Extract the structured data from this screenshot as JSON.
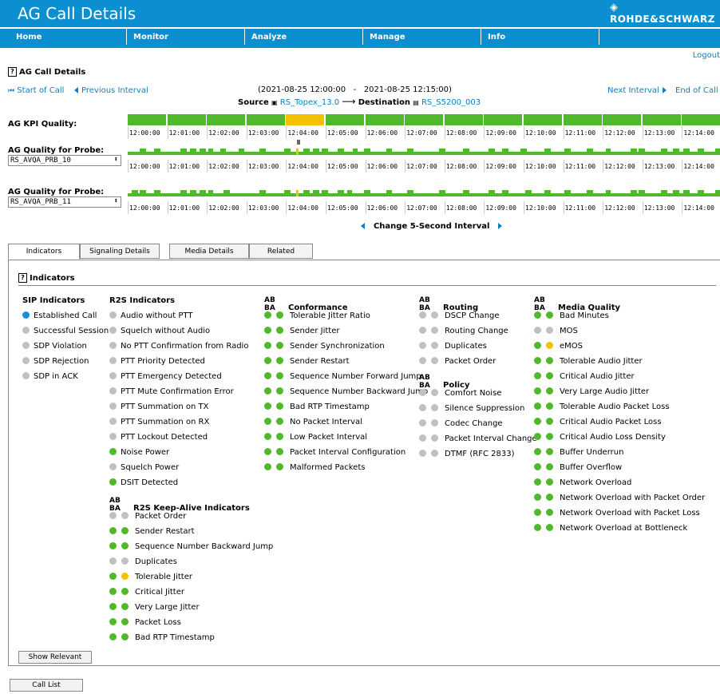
{
  "app": {
    "title": "AG Call Details",
    "brand": "ROHDE&SCHWARZ"
  },
  "menu": [
    "Home",
    "Monitor",
    "Analyze",
    "Manage",
    "Info"
  ],
  "logout": "Logout",
  "section_title": "AG Call Details",
  "nav": {
    "start": "Start of Call",
    "prev": "Previous Interval",
    "next": "Next Interval",
    "end": "End of Call"
  },
  "interval": {
    "from": "(2021-08-25 12:00:00",
    "sep": "-",
    "to": "2021-08-25 12:15:00)"
  },
  "source": {
    "label": "Source",
    "name": "RS_Topex_13.0"
  },
  "destination": {
    "label": "Destination",
    "name": "RS_S5200_003"
  },
  "kpi": {
    "label": "AG KPI Quality:",
    "segments": [
      "good",
      "good",
      "good",
      "good",
      "warn",
      "good",
      "good",
      "good",
      "good",
      "good",
      "good",
      "good",
      "good",
      "good",
      "good"
    ]
  },
  "ticks": [
    "12:00:00",
    "12:01:00",
    "12:02:00",
    "12:03:00",
    "12:04:00",
    "12:05:00",
    "12:06:00",
    "12:07:00",
    "12:08:00",
    "12:09:00",
    "12:10:00",
    "12:11:00",
    "12:12:00",
    "12:13:00",
    "12:14:00"
  ],
  "probe1": {
    "label": "AG Quality for Probe:",
    "value": "RS_AVQA_PRB_10"
  },
  "probe2": {
    "label": "AG Quality for Probe:",
    "value": "RS_AVQA_PRB_11"
  },
  "change_interval": "Change 5-Second Interval",
  "tabs": [
    "Indicators",
    "Signaling Details",
    "Media Details",
    "Related"
  ],
  "indicators_title": "Indicators",
  "ab_ba": "AB BA",
  "colors": {
    "blue": "#1a8ed4",
    "gray": "#c0c0c0",
    "green": "#4fb82b",
    "yellow": "#f5c000"
  },
  "sip": {
    "title": "SIP Indicators",
    "items": [
      {
        "label": "Established Call",
        "c": "blue"
      },
      {
        "label": "Successful Session",
        "c": "gray"
      },
      {
        "label": "SDP Violation",
        "c": "gray"
      },
      {
        "label": "SDP Rejection",
        "c": "gray"
      },
      {
        "label": "SDP in ACK",
        "c": "gray"
      }
    ]
  },
  "r2s": {
    "title": "R2S Indicators",
    "items": [
      {
        "label": "Audio without PTT",
        "c": "gray"
      },
      {
        "label": "Squelch without Audio",
        "c": "gray"
      },
      {
        "label": "No PTT Confirmation from Radio",
        "c": "gray"
      },
      {
        "label": "PTT Priority Detected",
        "c": "gray"
      },
      {
        "label": "PTT Emergency Detected",
        "c": "gray"
      },
      {
        "label": "PTT Mute Confirmation Error",
        "c": "gray"
      },
      {
        "label": "PTT Summation on TX",
        "c": "gray"
      },
      {
        "label": "PTT Summation on RX",
        "c": "gray"
      },
      {
        "label": "PTT Lockout Detected",
        "c": "gray"
      },
      {
        "label": "Noise Power",
        "c": "green"
      },
      {
        "label": "Squelch Power",
        "c": "gray"
      },
      {
        "label": "DSIT Detected",
        "c": "green"
      }
    ]
  },
  "keepalive": {
    "title": "R2S Keep-Alive Indicators",
    "items": [
      {
        "label": "Packet Order",
        "a": "gray",
        "b": "gray"
      },
      {
        "label": "Sender Restart",
        "a": "green",
        "b": "green"
      },
      {
        "label": "Sequence Number Backward Jump",
        "a": "green",
        "b": "green"
      },
      {
        "label": "Duplicates",
        "a": "gray",
        "b": "gray"
      },
      {
        "label": "Tolerable Jitter",
        "a": "green",
        "b": "yellow"
      },
      {
        "label": "Critical Jitter",
        "a": "green",
        "b": "green"
      },
      {
        "label": "Very Large Jitter",
        "a": "green",
        "b": "green"
      },
      {
        "label": "Packet Loss",
        "a": "green",
        "b": "green"
      },
      {
        "label": "Bad RTP Timestamp",
        "a": "green",
        "b": "green"
      }
    ]
  },
  "conformance": {
    "title": "Conformance",
    "items": [
      {
        "label": "Tolerable Jitter Ratio",
        "a": "green",
        "b": "green"
      },
      {
        "label": "Sender Jitter",
        "a": "green",
        "b": "green"
      },
      {
        "label": "Sender Synchronization",
        "a": "green",
        "b": "green"
      },
      {
        "label": "Sender Restart",
        "a": "green",
        "b": "green"
      },
      {
        "label": "Sequence Number Forward Jump",
        "a": "green",
        "b": "green"
      },
      {
        "label": "Sequence Number Backward Jump",
        "a": "green",
        "b": "green"
      },
      {
        "label": "Bad RTP Timestamp",
        "a": "green",
        "b": "green"
      },
      {
        "label": "No Packet Interval",
        "a": "green",
        "b": "green"
      },
      {
        "label": "Low Packet Interval",
        "a": "green",
        "b": "green"
      },
      {
        "label": "Packet Interval Configuration",
        "a": "green",
        "b": "green"
      },
      {
        "label": "Malformed Packets",
        "a": "green",
        "b": "green"
      }
    ]
  },
  "routing": {
    "title": "Routing",
    "items": [
      {
        "label": "DSCP Change",
        "a": "gray",
        "b": "gray"
      },
      {
        "label": "Routing Change",
        "a": "gray",
        "b": "gray"
      },
      {
        "label": "Duplicates",
        "a": "gray",
        "b": "gray"
      },
      {
        "label": "Packet Order",
        "a": "gray",
        "b": "gray"
      }
    ]
  },
  "policy": {
    "title": "Policy",
    "items": [
      {
        "label": "Comfort Noise",
        "a": "gray",
        "b": "gray"
      },
      {
        "label": "Silence Suppression",
        "a": "gray",
        "b": "gray"
      },
      {
        "label": "Codec Change",
        "a": "gray",
        "b": "gray"
      },
      {
        "label": "Packet Interval Change",
        "a": "gray",
        "b": "gray"
      },
      {
        "label": "DTMF (RFC 2833)",
        "a": "gray",
        "b": "gray"
      }
    ]
  },
  "media": {
    "title": "Media Quality",
    "items": [
      {
        "label": "Bad Minutes",
        "a": "green",
        "b": "green"
      },
      {
        "label": "MOS",
        "a": "gray",
        "b": "gray"
      },
      {
        "label": "eMOS",
        "a": "green",
        "b": "yellow"
      },
      {
        "label": "Tolerable Audio Jitter",
        "a": "green",
        "b": "green"
      },
      {
        "label": "Critical Audio Jitter",
        "a": "green",
        "b": "green"
      },
      {
        "label": "Very Large Audio Jitter",
        "a": "green",
        "b": "green"
      },
      {
        "label": "Tolerable Audio Packet Loss",
        "a": "green",
        "b": "green"
      },
      {
        "label": "Critical Audio Packet Loss",
        "a": "green",
        "b": "green"
      },
      {
        "label": "Critical Audio Loss Density",
        "a": "green",
        "b": "green"
      },
      {
        "label": "Buffer Underrun",
        "a": "green",
        "b": "green"
      },
      {
        "label": "Buffer Overflow",
        "a": "green",
        "b": "green"
      },
      {
        "label": "Network Overload",
        "a": "green",
        "b": "green"
      },
      {
        "label": "Network Overload with Packet Order",
        "a": "green",
        "b": "green"
      },
      {
        "label": "Network Overload with Packet Loss",
        "a": "green",
        "b": "green"
      },
      {
        "label": "Network Overload at Bottleneck",
        "a": "green",
        "b": "green"
      }
    ]
  },
  "buttons": {
    "show_relevant": "Show Relevant",
    "call_list": "Call List"
  }
}
